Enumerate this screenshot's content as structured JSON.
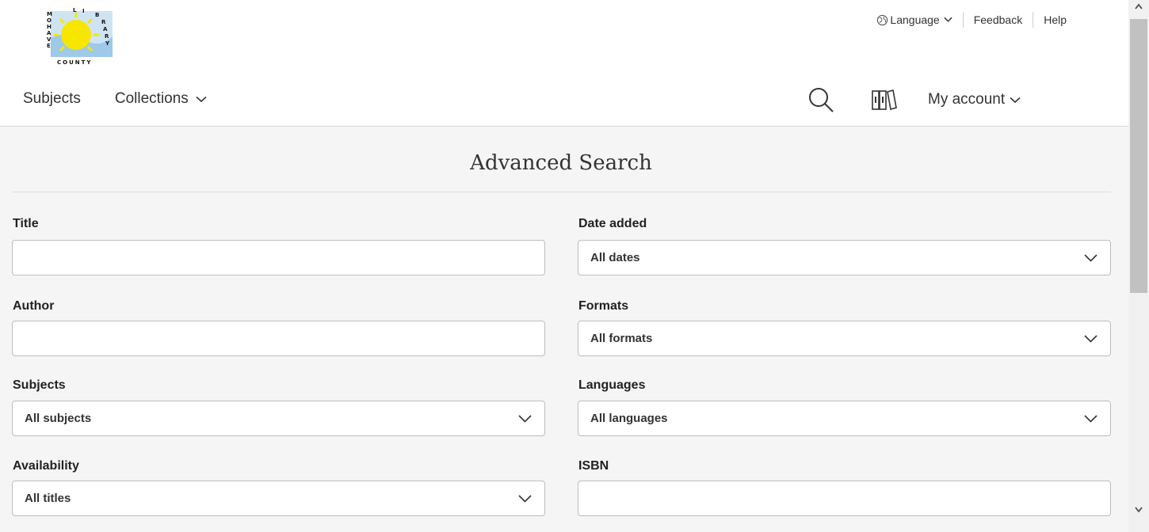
{
  "logo": {
    "letters_left": [
      "M",
      "O",
      "H",
      "A",
      "V",
      "E"
    ],
    "letters_top": [
      "L",
      "I",
      "B",
      "R",
      "A",
      "R",
      "Y"
    ],
    "county": "COUNTY"
  },
  "utility": {
    "language": "Language",
    "feedback": "Feedback",
    "help": "Help"
  },
  "nav": {
    "subjects": "Subjects",
    "collections": "Collections",
    "account": "My account"
  },
  "page": {
    "title": "Advanced Search"
  },
  "form": {
    "title_label": "Title",
    "title_value": "",
    "author_label": "Author",
    "author_value": "",
    "subjects_label": "Subjects",
    "subjects_value": "All subjects",
    "availability_label": "Availability",
    "availability_value": "All titles",
    "date_label": "Date added",
    "date_value": "All dates",
    "formats_label": "Formats",
    "formats_value": "All formats",
    "languages_label": "Languages",
    "languages_value": "All languages",
    "isbn_label": "ISBN",
    "isbn_value": ""
  },
  "colors": {
    "page_bg": "#f5f5f5",
    "header_bg": "#ffffff",
    "logo_sun": "#f6e600",
    "logo_sky": "#9ec9e8"
  }
}
